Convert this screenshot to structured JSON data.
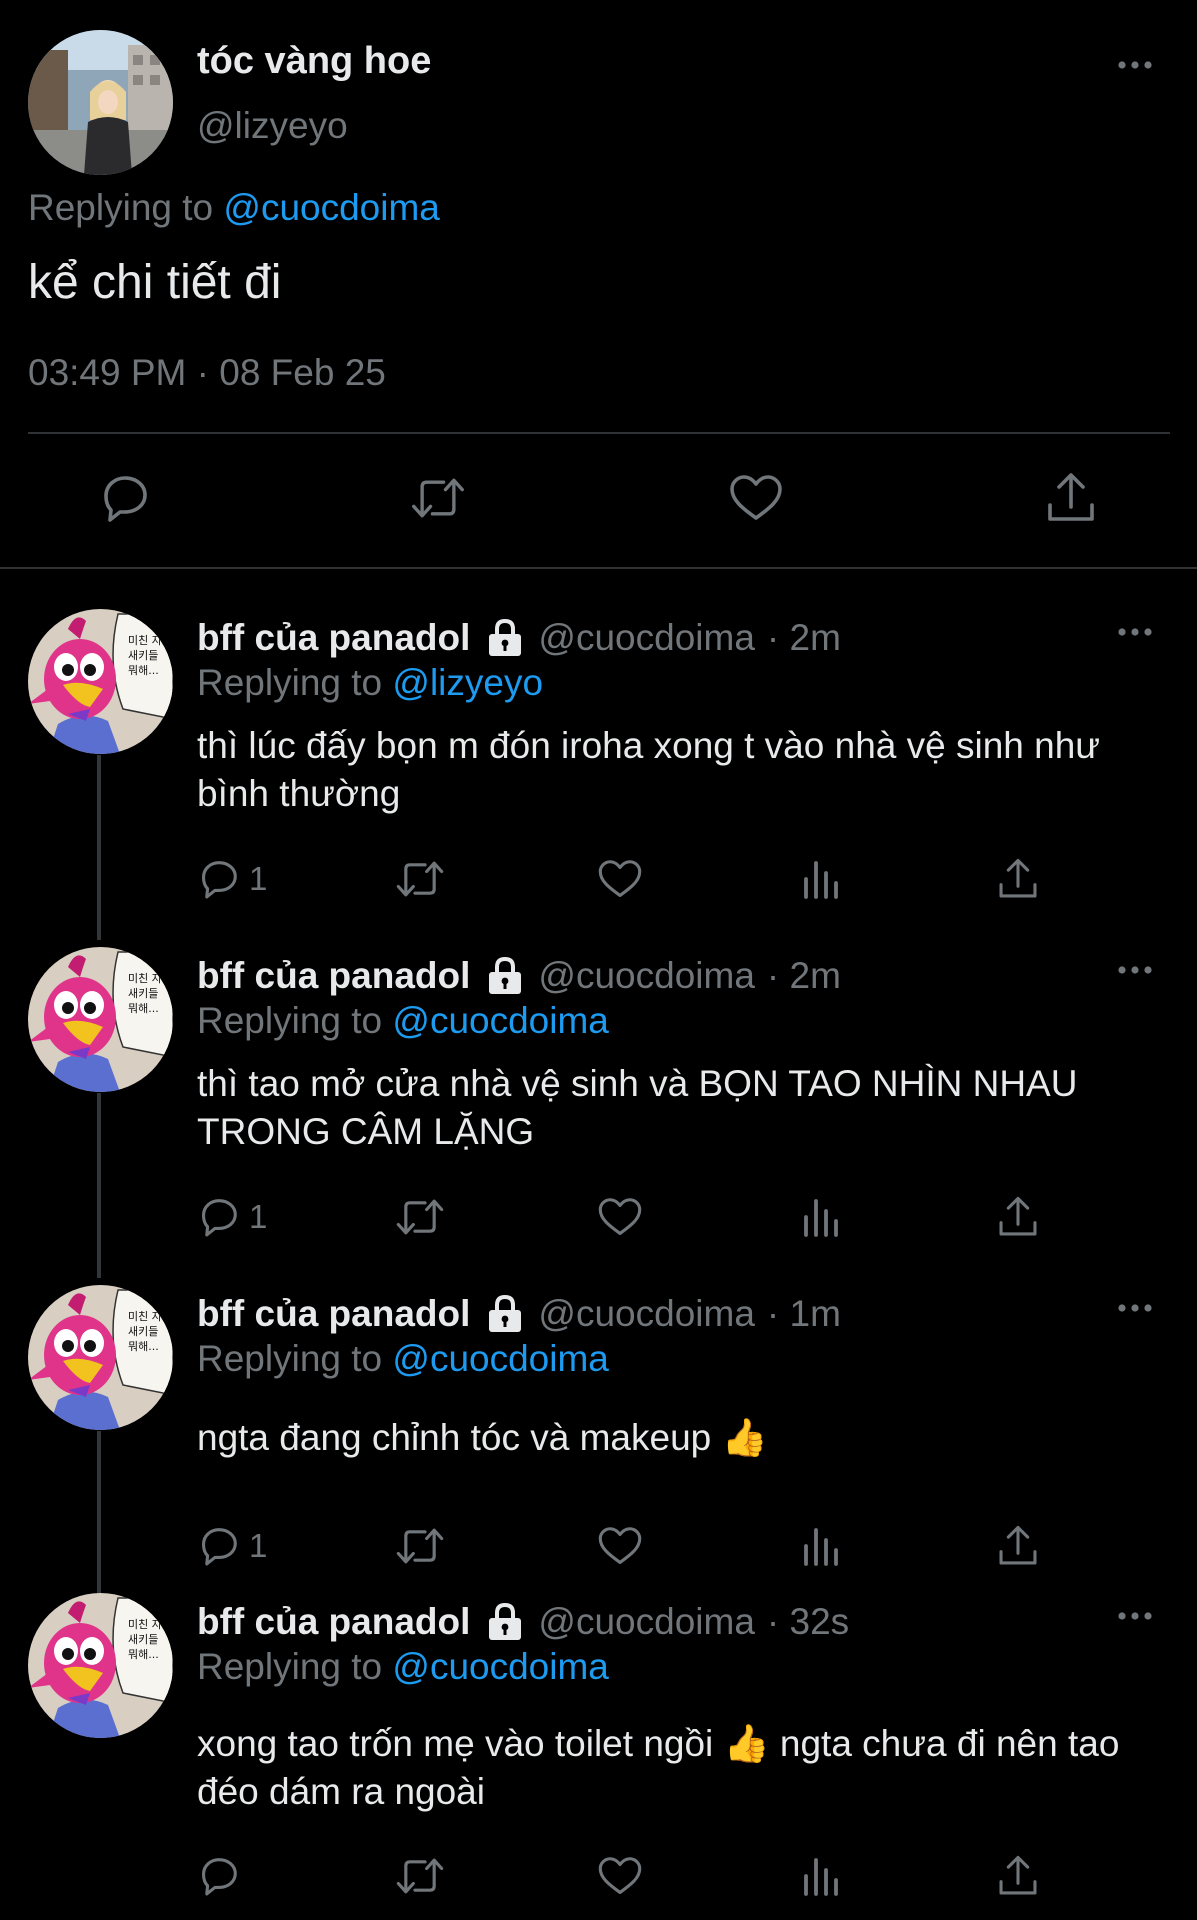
{
  "main_tweet": {
    "display_name": "tóc vàng hoe",
    "handle": "@lizyeyo",
    "replying_prefix": "Replying to",
    "replying_to": "@cuocdoima",
    "text": "kể chi tiết đi",
    "timestamp": "03:49 PM · 08 Feb 25",
    "actions": [
      "reply-icon",
      "retweet-icon",
      "like-icon",
      "share-icon"
    ]
  },
  "replies": [
    {
      "display_name": "bff của panadol",
      "handle": "@cuocdoima",
      "age": "· 2m",
      "replying_prefix": "Replying to",
      "replying_to": "@lizyeyo",
      "text": "thì lúc đấy bọn m đón iroha xong t vào nhà vệ sinh như bình thường",
      "reply_count": "1"
    },
    {
      "display_name": "bff của panadol",
      "handle": "@cuocdoima",
      "age": "· 2m",
      "replying_prefix": "Replying to",
      "replying_to": "@cuocdoima",
      "text": "thì tao mở cửa nhà vệ sinh và BỌN TAO NHÌN NHAU TRONG CÂM LẶNG",
      "reply_count": "1"
    },
    {
      "display_name": "bff của panadol",
      "handle": "@cuocdoima",
      "age": "· 1m",
      "replying_prefix": "Replying to",
      "replying_to": "@cuocdoima",
      "text": "ngta đang chỉnh tóc và makeup 👍",
      "reply_count": "1"
    },
    {
      "display_name": "bff của panadol",
      "handle": "@cuocdoima",
      "age": "· 32s",
      "replying_prefix": "Replying to",
      "replying_to": "@cuocdoima",
      "text": "xong tao trốn mẹ vào toilet ngồi 👍  ngta chưa đi nên tao đéo dám ra ngoài",
      "reply_count": ""
    }
  ],
  "colors": {
    "background": "#000000",
    "text": "#e7e9ea",
    "muted": "#71767b",
    "link": "#1d9bf0",
    "divider": "#2f3336"
  }
}
